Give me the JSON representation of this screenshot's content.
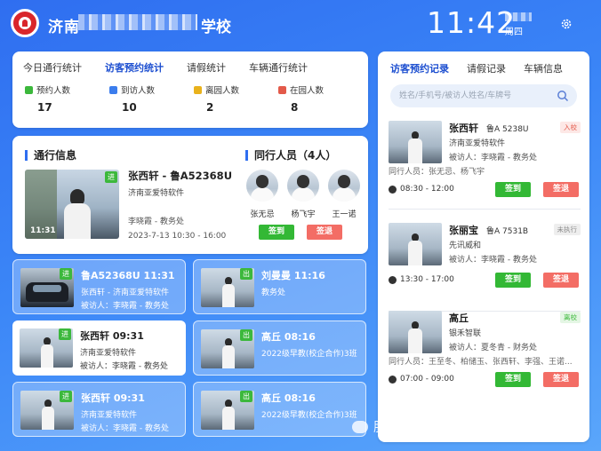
{
  "header": {
    "school_prefix": "济南",
    "school_suffix": "学校",
    "time": "11:42",
    "weekday": "周四"
  },
  "stats": {
    "tabs": [
      "今日通行统计",
      "访客预约统计",
      "请假统计",
      "车辆通行统计"
    ],
    "active_tab": 1,
    "items": [
      {
        "label": "预约人数",
        "value": "17",
        "color": "#3cb83c"
      },
      {
        "label": "到访人数",
        "value": "10",
        "color": "#3b7ded"
      },
      {
        "label": "离园人数",
        "value": "2",
        "color": "#e9b21c"
      },
      {
        "label": "在园人数",
        "value": "8",
        "color": "#e35a4a"
      }
    ]
  },
  "info": {
    "title": "通行信息",
    "tag": "进",
    "photo_time": "11:31",
    "visitor": "张西轩 - 鲁A52368U",
    "company": "济南亚爱特软件",
    "host": "李晓霞 - 教务处",
    "date": "2023-7-13 10:30 - 16:00",
    "companions_title": "同行人员（4人）",
    "companions": [
      "张无忌",
      "杨飞宇",
      "王一诺"
    ],
    "checkin": "签到",
    "checkout": "签退"
  },
  "cards": [
    {
      "tag": "进",
      "title": "鲁A52368U  11:31",
      "l1": "张西轩 - 济南亚爱特软件",
      "l2": "被访人：李晓霞 - 教务处"
    },
    {
      "tag": "出",
      "title": "刘曼曼  11:16",
      "l1": "教务处",
      "l2": ""
    },
    {
      "tag": "进",
      "title": "张西轩  09:31",
      "l1": "济南亚爱特软件",
      "l2": "被访人：李晓霞 - 教务处"
    },
    {
      "tag": "出",
      "title": "高丘  08:16",
      "l1": "2022级早教(校企合作)3班",
      "l2": ""
    },
    {
      "tag": "进",
      "title": "张西轩  09:31",
      "l1": "济南亚爱特软件",
      "l2": "被访人：李晓霞 - 教务处"
    },
    {
      "tag": "出",
      "title": "高丘  08:16",
      "l1": "2022级早教(校企合作)3班",
      "l2": ""
    }
  ],
  "right": {
    "tabs": [
      "访客预约记录",
      "请假记录",
      "车辆信息"
    ],
    "search_placeholder": "姓名/手机号/被访人姓名/车牌号",
    "records": [
      {
        "name": "张西轩",
        "plate": "鲁A 5238U",
        "badge": "入校",
        "badge_color": "#e35a4a",
        "badge_bg": "#fde8e6",
        "company": "济南亚爱特软件",
        "host": "被访人：李晓霞 - 教务处",
        "companions": "同行人员：张无忌、杨飞宇",
        "time": "08:30 - 12:00"
      },
      {
        "name": "张丽宝",
        "plate": "鲁A 7531B",
        "badge": "未执行",
        "badge_color": "#888888",
        "badge_bg": "#eeeeee",
        "company": "先讯威和",
        "host": "被访人：李晓霞 - 教务处",
        "companions": "",
        "time": "13:30 - 17:00"
      },
      {
        "name": "高丘",
        "plate": "",
        "badge": "离校",
        "badge_color": "#3cb83c",
        "badge_bg": "#e4f6e4",
        "company": "银禾智联",
        "host": "被访人：夏冬青 - 财务处",
        "companions": "同行人员：王至冬、柏储玉、张西轩、李强、王诺...",
        "time": "07:00 - 09:00"
      }
    ],
    "checkin": "签到",
    "checkout": "签退"
  },
  "watermark": "服务号 · 校保-校园安全大脑"
}
